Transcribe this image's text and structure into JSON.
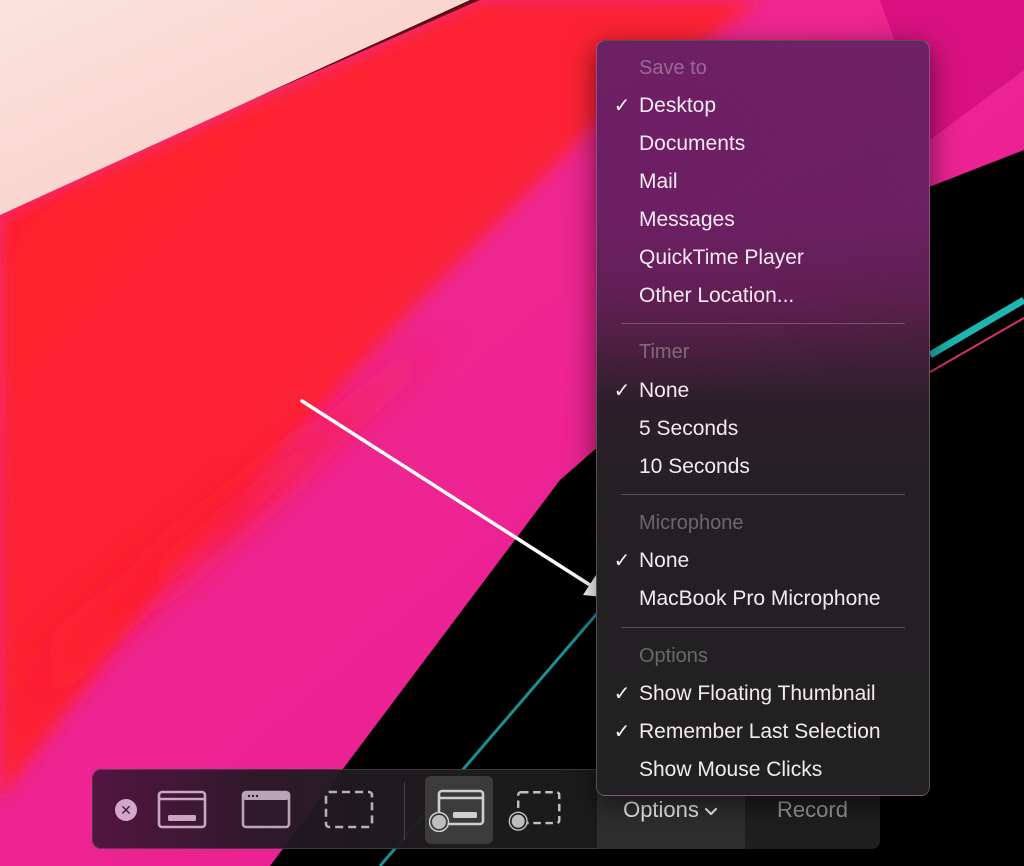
{
  "colors": {
    "menu_text": "#f2eaf0",
    "menu_header_text": "rgba(255,255,255,0.32)",
    "toolbar_close_bg": "#d5a6cc",
    "toolbar_icon": "#c9a6c2",
    "toolbar_icon_selected": "#cfcfcf",
    "record_text": "#9a9a9a",
    "annotation_arrow": "#ffffff"
  },
  "menu": {
    "sections": [
      {
        "header": "Save to",
        "items": [
          {
            "label": "Desktop",
            "checked": true
          },
          {
            "label": "Documents",
            "checked": false
          },
          {
            "label": "Mail",
            "checked": false
          },
          {
            "label": "Messages",
            "checked": false
          },
          {
            "label": "QuickTime Player",
            "checked": false
          },
          {
            "label": "Other Location...",
            "checked": false
          }
        ]
      },
      {
        "header": "Timer",
        "items": [
          {
            "label": "None",
            "checked": true
          },
          {
            "label": "5 Seconds",
            "checked": false
          },
          {
            "label": "10 Seconds",
            "checked": false
          }
        ]
      },
      {
        "header": "Microphone",
        "items": [
          {
            "label": "None",
            "checked": true
          },
          {
            "label": "MacBook Pro Microphone",
            "checked": false
          }
        ]
      },
      {
        "header": "Options",
        "items": [
          {
            "label": "Show Floating Thumbnail",
            "checked": true
          },
          {
            "label": "Remember Last Selection",
            "checked": true
          },
          {
            "label": "Show Mouse Clicks",
            "checked": false
          }
        ]
      }
    ],
    "check_glyph": "✓"
  },
  "toolbar": {
    "close_glyph": "✕",
    "buttons": [
      {
        "name": "capture-entire-screen",
        "icon": "screen-icon",
        "selected": false
      },
      {
        "name": "capture-selected-window",
        "icon": "window-icon",
        "selected": false
      },
      {
        "name": "capture-selected-portion",
        "icon": "dashed-selection-icon",
        "selected": false
      },
      {
        "name": "record-entire-screen",
        "icon": "record-screen-icon",
        "selected": true
      },
      {
        "name": "record-selected-portion",
        "icon": "record-selection-icon",
        "selected": false
      }
    ],
    "options_label": "Options",
    "options_chevron": "⌄",
    "record_label": "Record"
  }
}
